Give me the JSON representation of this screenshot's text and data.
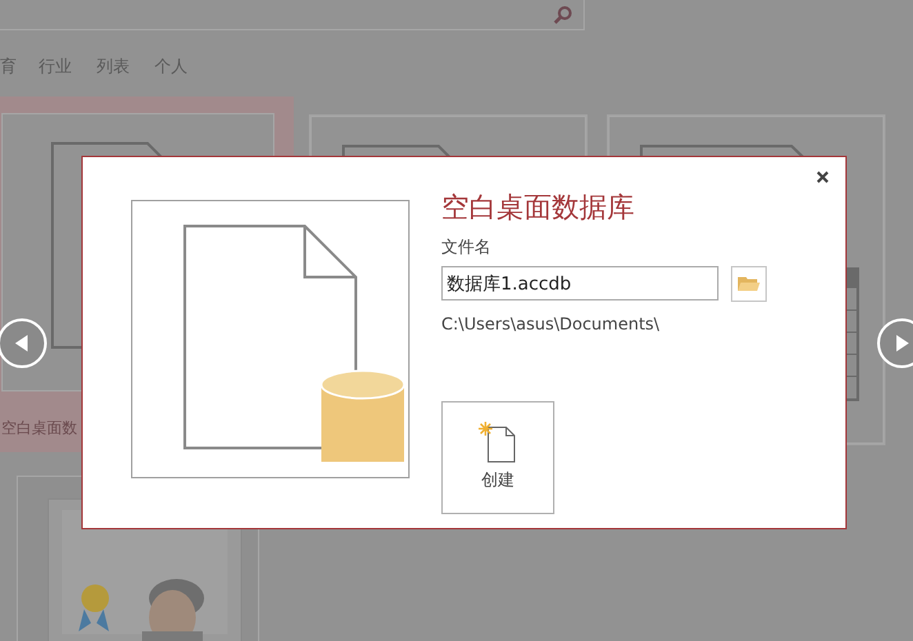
{
  "categories": [
    {
      "label": "育"
    },
    {
      "label": "行业"
    },
    {
      "label": "列表"
    },
    {
      "label": "个人"
    }
  ],
  "templates": [
    {
      "kind": "blank",
      "selected": true,
      "label": "空白桌面数"
    },
    {
      "kind": "blank",
      "selected": false
    },
    {
      "kind": "table",
      "selected": false
    },
    {
      "kind": "picture",
      "selected": false
    }
  ],
  "dialog": {
    "title": "空白桌面数据库",
    "file_label": "文件名",
    "file_name": "数据库1.accdb",
    "path": "C:\\Users\\asus\\Documents\\",
    "create_label": "创建"
  }
}
